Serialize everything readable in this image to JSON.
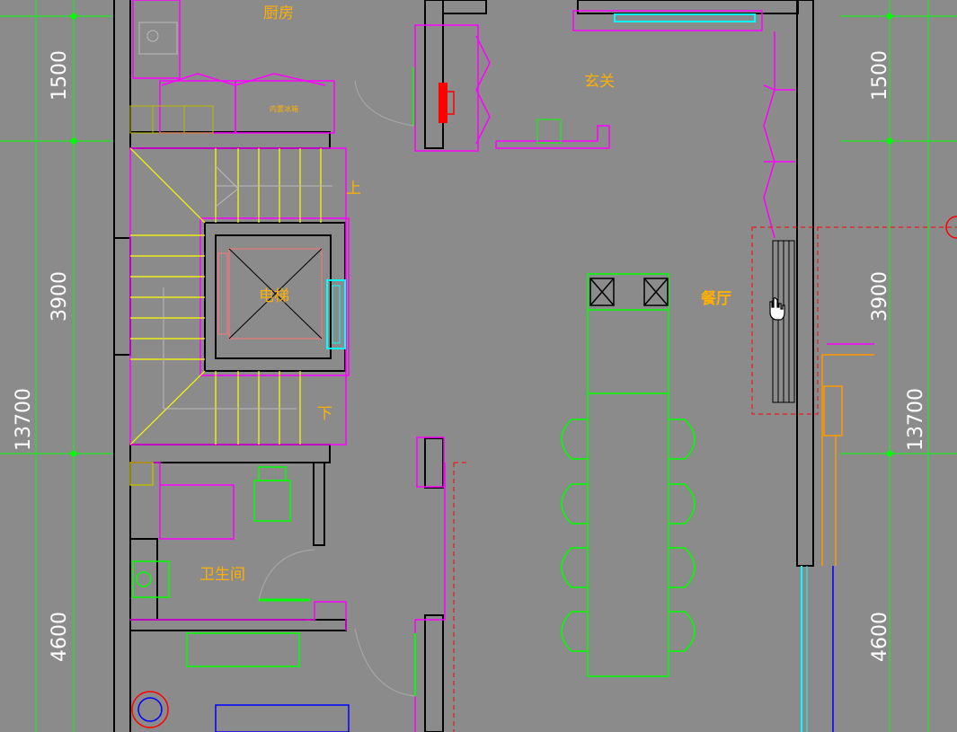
{
  "app": {
    "accent": "#ffb000",
    "canvas_bg": "#8b8b8b"
  },
  "rooms": {
    "kitchen": "厨房",
    "entrance": "玄关",
    "elevator": "电梯",
    "dining": "餐厅",
    "bathroom": "卫生间",
    "stairs_up": "上",
    "stairs_down": "下",
    "appliance": "内置冰箱"
  },
  "dimensions": {
    "left": {
      "top": "1500",
      "mid": "3900",
      "total": "13700",
      "bottom": "4600"
    },
    "right": {
      "top": "1500",
      "mid": "3900",
      "total": "13700",
      "bottom": "4600"
    }
  },
  "cursor": {
    "type": "hand-pointer"
  },
  "colors": {
    "wall": "#000000",
    "furniture": "#00ff00",
    "fixture": "#ff00ff",
    "stair": "#ffff00",
    "glass": "#00ffff",
    "dash": "#ff0000",
    "dim_line": "#00ff00"
  }
}
